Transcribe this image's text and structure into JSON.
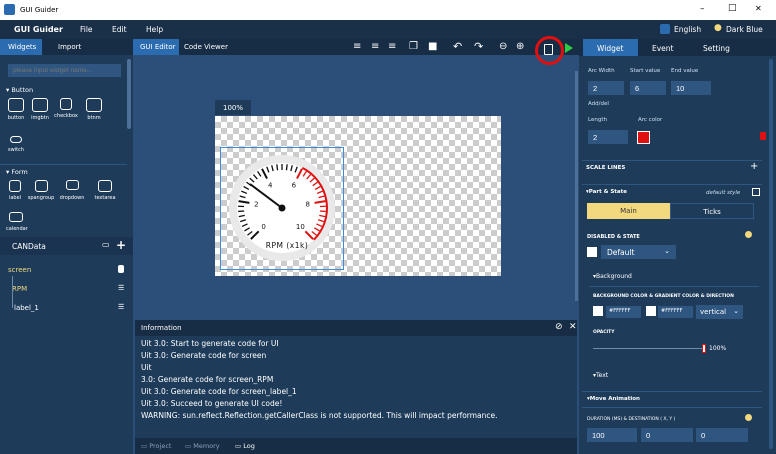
{
  "window": {
    "title": "GUI Guider",
    "controls": {
      "minimize": "–",
      "maximize": "□",
      "close": "✕"
    }
  },
  "menu": {
    "brand": "GUI Guider",
    "items": [
      "File",
      "Edit",
      "Help"
    ],
    "language": "English",
    "theme": "Dark Blue"
  },
  "left": {
    "tabs": [
      "Widgets",
      "Import"
    ],
    "search_placeholder": "please input widget name...",
    "groups": [
      {
        "title": "▾ Button",
        "items": [
          "button",
          "imgbtn",
          "checkbox",
          "btnm",
          "switch"
        ]
      },
      {
        "title": "▾ Form",
        "items": [
          "label",
          "spangroup",
          "dropdown",
          "textarea",
          "calendar"
        ]
      }
    ],
    "candata": {
      "title": "CANData",
      "tree": [
        "screen",
        "RPM",
        "label_1"
      ]
    }
  },
  "center": {
    "tabs": [
      "GUI Editor",
      "Code Viewer"
    ],
    "zoom": "100%",
    "gauge": {
      "labels": [
        "0",
        "2",
        "4",
        "6",
        "8",
        "10"
      ],
      "unit": "RPM (x1k)"
    },
    "info": {
      "title": "Information",
      "lines": [
        "Uit 3.0: Start to generate code for UI",
        "Uit 3.0: Generate code for screen",
        "Uit",
        "3.0: Generate code for screen_RPM",
        "Uit 3.0: Generate code for screen_label_1",
        "Uit 3.0: Succeed to generate UI code!",
        "WARNING: sun.reflect.Reflection.getCallerClass is not supported. This will impact performance."
      ],
      "footer_tabs": [
        "Project",
        "Memory",
        "Log"
      ]
    }
  },
  "right": {
    "tabs": [
      "Widget",
      "Event",
      "Setting"
    ],
    "arc": {
      "headers": [
        "Arc Width",
        "Start value",
        "End value"
      ],
      "values": [
        "2",
        "6",
        "10"
      ],
      "add": "Add/del",
      "len_label": "Length",
      "color_label": "Arc color",
      "length": "2",
      "color": "#e01010"
    },
    "scale_lines": "SCALE LINES",
    "part_state": "▾Part & State",
    "default_style": "default style",
    "parts": [
      "Main",
      "Ticks"
    ],
    "disabled_state": "DISABLED & STATE",
    "state_value": "Default",
    "background": "▾Background",
    "bg_title": "BACKGROUND COLOR & GRADIENT COLOR & DIRECTION",
    "bg_color1": "#FFFFFF",
    "bg_color2": "#FFFFFF",
    "direction": "vertical",
    "opacity_label": "OPACITY",
    "opacity_value": "100%",
    "opacity": 1.0,
    "text_section": "▾Text",
    "move_anim": "▾Move Animation",
    "duration_label": "DURATION (MS) & DESTINATION ( X, Y )",
    "duration": "100",
    "dest_x": "0",
    "dest_y": "0"
  },
  "colors": {
    "accent": "#f2d97e",
    "brand": "#2b6cb0",
    "arc": "#e01010"
  }
}
